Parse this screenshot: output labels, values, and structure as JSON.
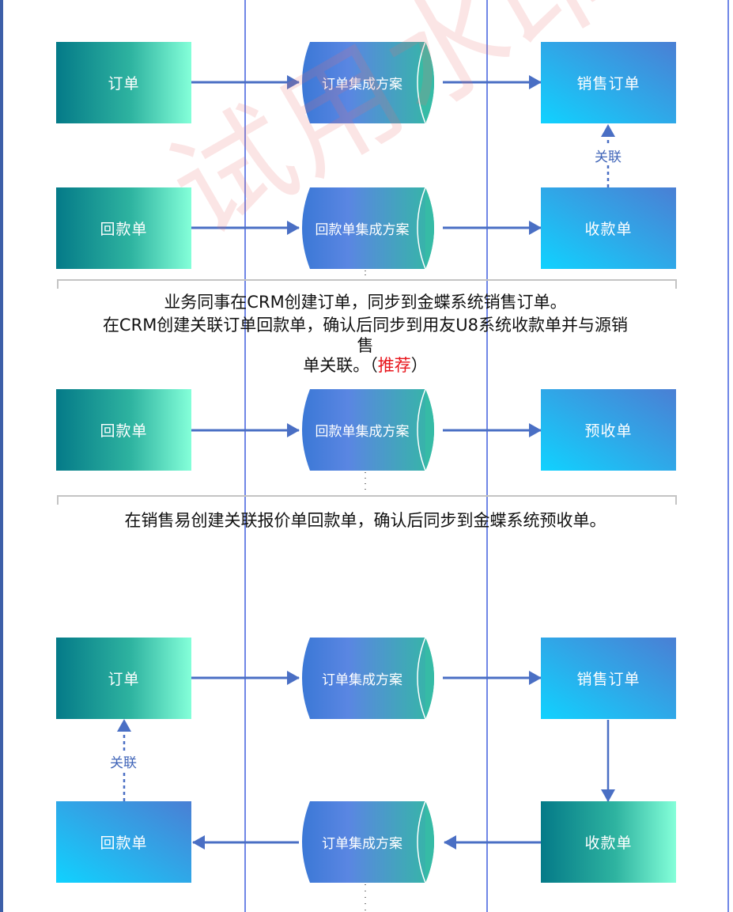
{
  "diagram1": {
    "nodes": {
      "order": "订单",
      "order_solution": "订单集成方案",
      "sales_order": "销售订单",
      "payment": "回款单",
      "payment_solution": "回款单集成方案",
      "receipt": "收款单"
    },
    "relation_label": "关联",
    "caption_line1": "业务同事在CRM创建订单，同步到金蝶系统销售订单。",
    "caption_line2": "在CRM创建关联订单回款单，确认后同步到用友U8系统收款单并与源销",
    "caption_line3": "售",
    "caption_line4_prefix": "单关联。（",
    "caption_line4_highlight": "推荐",
    "caption_line4_suffix": "）"
  },
  "diagram2": {
    "nodes": {
      "payment": "回款单",
      "payment_solution": "回款单集成方案",
      "advance_receipt": "预收单"
    },
    "caption": "在销售易创建关联报价单回款单，确认后同步到金蝶系统预收单。"
  },
  "diagram3": {
    "nodes": {
      "order": "订单",
      "order_solution_top": "订单集成方案",
      "sales_order": "销售订单",
      "payment": "回款单",
      "order_solution_bottom": "订单集成方案",
      "receipt": "收款单"
    },
    "relation_label": "关联"
  },
  "watermark": "试用水印",
  "colors": {
    "arrow": "#4a6fc4",
    "lane_line": "#6f86e6",
    "highlight": "#e8141b"
  }
}
